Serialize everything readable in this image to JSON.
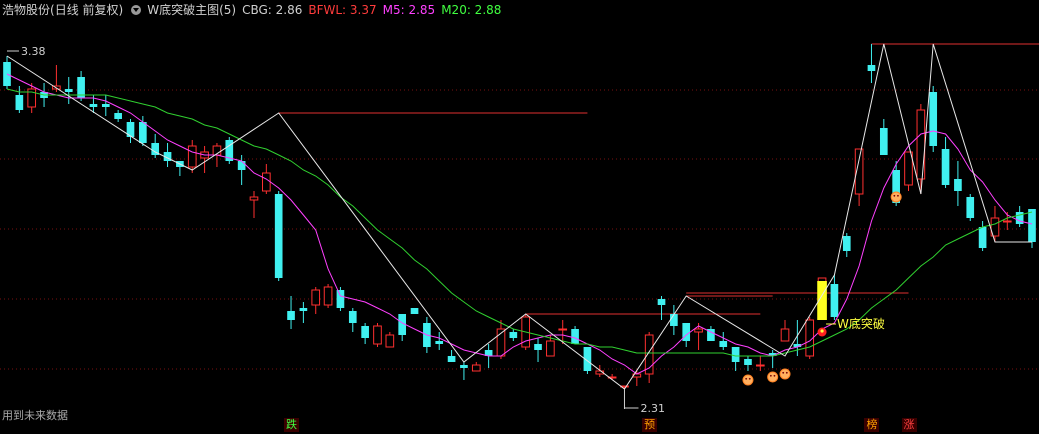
{
  "header": {
    "stock": "浩物股份",
    "period": "(日线 前复权)",
    "indicator": "W底突破主图(5)",
    "cbg": "CBG: 2.86",
    "bfwl": "BFWL: 3.37",
    "m5": "M5: 2.85",
    "m20": "M20: 2.88",
    "colors": {
      "stock": "#d0d0d0",
      "cbg": "#d0d0d0",
      "bfwl": "#ff3c3c",
      "m5": "#ff40ff",
      "m20": "#40ff40"
    }
  },
  "footer": {
    "future_data": "用到未来数据"
  },
  "markers": [
    {
      "text": "跌",
      "color": "#40ff40",
      "bg": "#3a0000"
    },
    {
      "text": "预",
      "color": "#ffa000",
      "bg": "#3a0000"
    },
    {
      "text": "榜",
      "color": "#ffa000",
      "bg": "#3a0000"
    },
    {
      "text": "涨",
      "color": "#ff4040",
      "bg": "#3a0000"
    }
  ],
  "chart_data": {
    "type": "candlestick",
    "ylim": [
      2.22,
      3.52
    ],
    "grid": true,
    "annotations": {
      "high": "3.38",
      "low": "2.31",
      "signal": "W底突破"
    },
    "candles": [
      [
        3.38,
        3.4,
        3.29,
        3.3
      ],
      [
        3.27,
        3.3,
        3.21,
        3.22
      ],
      [
        3.23,
        3.31,
        3.21,
        3.29
      ],
      [
        3.28,
        3.31,
        3.23,
        3.26
      ],
      [
        3.29,
        3.37,
        3.28,
        3.3
      ],
      [
        3.29,
        3.33,
        3.24,
        3.28
      ],
      [
        3.33,
        3.35,
        3.25,
        3.26
      ],
      [
        3.24,
        3.27,
        3.21,
        3.23
      ],
      [
        3.24,
        3.27,
        3.2,
        3.23
      ],
      [
        3.21,
        3.22,
        3.18,
        3.19
      ],
      [
        3.18,
        3.19,
        3.11,
        3.13
      ],
      [
        3.18,
        3.2,
        3.1,
        3.11
      ],
      [
        3.11,
        3.14,
        3.06,
        3.07
      ],
      [
        3.08,
        3.11,
        3.03,
        3.05
      ],
      [
        3.05,
        3.05,
        3.0,
        3.03
      ],
      [
        3.03,
        3.12,
        3.01,
        3.1
      ],
      [
        3.06,
        3.1,
        3.01,
        3.08
      ],
      [
        3.07,
        3.11,
        3.03,
        3.1
      ],
      [
        3.12,
        3.13,
        3.04,
        3.05
      ],
      [
        3.05,
        3.07,
        2.97,
        3.02
      ],
      [
        2.92,
        2.95,
        2.86,
        2.93
      ],
      [
        2.95,
        3.04,
        2.94,
        3.01
      ],
      [
        2.94,
        2.95,
        2.65,
        2.66
      ],
      [
        2.55,
        2.6,
        2.49,
        2.52
      ],
      [
        2.56,
        2.58,
        2.51,
        2.55
      ],
      [
        2.57,
        2.63,
        2.54,
        2.62
      ],
      [
        2.57,
        2.64,
        2.56,
        2.63
      ],
      [
        2.62,
        2.63,
        2.55,
        2.56
      ],
      [
        2.55,
        2.56,
        2.48,
        2.51
      ],
      [
        2.5,
        2.51,
        2.44,
        2.46
      ],
      [
        2.44,
        2.51,
        2.43,
        2.5
      ],
      [
        2.43,
        2.48,
        2.43,
        2.47
      ],
      [
        2.54,
        2.54,
        2.45,
        2.47
      ],
      [
        2.56,
        2.56,
        2.54,
        2.54
      ],
      [
        2.51,
        2.53,
        2.41,
        2.43
      ],
      [
        2.45,
        2.48,
        2.42,
        2.44
      ],
      [
        2.4,
        2.42,
        2.38,
        2.38
      ],
      [
        2.37,
        2.38,
        2.32,
        2.36
      ],
      [
        2.35,
        2.38,
        2.35,
        2.37
      ],
      [
        2.42,
        2.44,
        2.36,
        2.4
      ],
      [
        2.4,
        2.52,
        2.39,
        2.49
      ],
      [
        2.48,
        2.49,
        2.45,
        2.46
      ],
      [
        2.43,
        2.54,
        2.42,
        2.53
      ],
      [
        2.44,
        2.46,
        2.38,
        2.42
      ],
      [
        2.4,
        2.47,
        2.4,
        2.45
      ],
      [
        2.49,
        2.52,
        2.44,
        2.49
      ],
      [
        2.49,
        2.5,
        2.44,
        2.44
      ],
      [
        2.43,
        2.43,
        2.34,
        2.35
      ],
      [
        2.34,
        2.37,
        2.33,
        2.35
      ],
      [
        2.33,
        2.34,
        2.32,
        2.33
      ],
      [
        2.3,
        2.3,
        2.29,
        2.3
      ],
      [
        2.33,
        2.35,
        2.3,
        2.34
      ],
      [
        2.34,
        2.48,
        2.31,
        2.47
      ],
      [
        2.59,
        2.6,
        2.52,
        2.57
      ],
      [
        2.54,
        2.57,
        2.47,
        2.5
      ],
      [
        2.51,
        2.51,
        2.43,
        2.45
      ],
      [
        2.48,
        2.51,
        2.42,
        2.49
      ],
      [
        2.49,
        2.5,
        2.45,
        2.45
      ],
      [
        2.45,
        2.48,
        2.42,
        2.43
      ],
      [
        2.43,
        2.43,
        2.35,
        2.38
      ],
      [
        2.39,
        2.4,
        2.35,
        2.37
      ],
      [
        2.37,
        2.4,
        2.35,
        2.37
      ],
      [
        2.41,
        2.42,
        2.36,
        2.4
      ],
      [
        2.45,
        2.52,
        2.45,
        2.49
      ],
      [
        2.44,
        2.52,
        2.4,
        2.43
      ],
      [
        2.4,
        2.53,
        2.39,
        2.52
      ],
      [
        2.57,
        2.66,
        2.53,
        2.66
      ],
      [
        2.64,
        2.67,
        2.52,
        2.53
      ],
      [
        2.8,
        2.81,
        2.73,
        2.75
      ],
      [
        2.94,
        3.09,
        2.9,
        3.09
      ],
      [
        3.37,
        3.44,
        3.31,
        3.35
      ],
      [
        3.16,
        3.19,
        3.07,
        3.07
      ],
      [
        3.02,
        3.05,
        2.9,
        2.91
      ],
      [
        2.97,
        3.08,
        2.95,
        3.08
      ],
      [
        2.99,
        3.24,
        2.94,
        3.22
      ],
      [
        3.28,
        3.3,
        3.08,
        3.1
      ],
      [
        3.09,
        3.13,
        2.96,
        2.97
      ],
      [
        2.99,
        3.05,
        2.9,
        2.95
      ],
      [
        2.93,
        2.94,
        2.85,
        2.86
      ],
      [
        2.83,
        2.85,
        2.75,
        2.76
      ],
      [
        2.8,
        2.9,
        2.78,
        2.86
      ],
      [
        2.85,
        2.88,
        2.82,
        2.85
      ],
      [
        2.88,
        2.9,
        2.83,
        2.84
      ],
      [
        2.89,
        2.89,
        2.76,
        2.78
      ]
    ],
    "series": [
      {
        "name": "M5",
        "values": [
          3.34,
          3.32,
          3.3,
          3.28,
          3.27,
          3.26,
          3.26,
          3.26,
          3.25,
          3.23,
          3.21,
          3.18,
          3.15,
          3.12,
          3.1,
          3.08,
          3.07,
          3.07,
          3.06,
          3.05,
          3.01,
          2.99,
          2.96,
          2.92,
          2.87,
          2.82,
          2.69,
          2.6,
          2.59,
          2.58,
          2.56,
          2.54,
          2.51,
          2.49,
          2.47,
          2.46,
          2.44,
          2.42,
          2.41,
          2.4,
          2.4,
          2.43,
          2.45,
          2.46,
          2.47,
          2.47,
          2.46,
          2.44,
          2.42,
          2.39,
          2.37,
          2.34,
          2.36,
          2.4,
          2.43,
          2.47,
          2.5,
          2.48,
          2.46,
          2.44,
          2.43,
          2.41,
          2.4,
          2.42,
          2.43,
          2.45,
          2.49,
          2.51,
          2.59,
          2.7,
          2.85,
          2.96,
          3.04,
          3.1,
          3.14,
          3.15,
          3.14,
          3.09,
          3.02,
          2.98,
          2.92,
          2.87,
          2.85,
          2.84
        ]
      },
      {
        "name": "M20",
        "values": [
          3.29,
          3.28,
          3.28,
          3.27,
          3.27,
          3.27,
          3.27,
          3.27,
          3.27,
          3.26,
          3.25,
          3.24,
          3.23,
          3.21,
          3.2,
          3.19,
          3.17,
          3.16,
          3.14,
          3.12,
          3.1,
          3.09,
          3.07,
          3.05,
          3.02,
          3.0,
          2.97,
          2.93,
          2.9,
          2.86,
          2.82,
          2.79,
          2.76,
          2.72,
          2.69,
          2.65,
          2.61,
          2.58,
          2.55,
          2.53,
          2.51,
          2.49,
          2.48,
          2.47,
          2.46,
          2.45,
          2.44,
          2.44,
          2.43,
          2.43,
          2.42,
          2.41,
          2.41,
          2.41,
          2.41,
          2.41,
          2.41,
          2.41,
          2.41,
          2.4,
          2.4,
          2.4,
          2.4,
          2.41,
          2.42,
          2.43,
          2.45,
          2.47,
          2.49,
          2.52,
          2.56,
          2.59,
          2.62,
          2.66,
          2.7,
          2.73,
          2.77,
          2.79,
          2.81,
          2.83,
          2.84,
          2.86,
          2.87,
          2.88
        ]
      }
    ],
    "zigzag": [
      [
        0,
        3.4
      ],
      [
        12,
        3.08
      ],
      [
        15,
        3.02
      ],
      [
        22,
        3.21
      ],
      [
        37,
        2.38
      ],
      [
        42,
        2.54
      ],
      [
        50,
        2.29
      ],
      [
        55,
        2.6
      ],
      [
        63,
        2.4
      ],
      [
        67,
        2.67
      ],
      [
        71,
        3.44
      ],
      [
        74,
        2.94
      ],
      [
        75,
        3.44
      ],
      [
        80,
        2.78
      ],
      [
        83,
        2.78
      ]
    ],
    "resistance_lines": [
      {
        "from": 22,
        "to": 47,
        "value": 3.21
      },
      {
        "from": 42,
        "to": 61,
        "value": 2.54
      },
      {
        "from": 55,
        "to": 62,
        "value": 2.6
      },
      {
        "from": 55,
        "to": 73,
        "value": 2.61
      },
      {
        "from": 70,
        "to": 84,
        "value": 3.44
      }
    ],
    "signal_bar": {
      "index": 66,
      "from": 2.52,
      "to": 2.65
    },
    "smiley_points": [
      [
        60,
        2.32
      ],
      [
        62,
        2.33
      ],
      [
        63,
        2.34
      ],
      [
        72,
        2.93
      ]
    ],
    "marker_indices": [
      23,
      52,
      70,
      73
    ]
  }
}
